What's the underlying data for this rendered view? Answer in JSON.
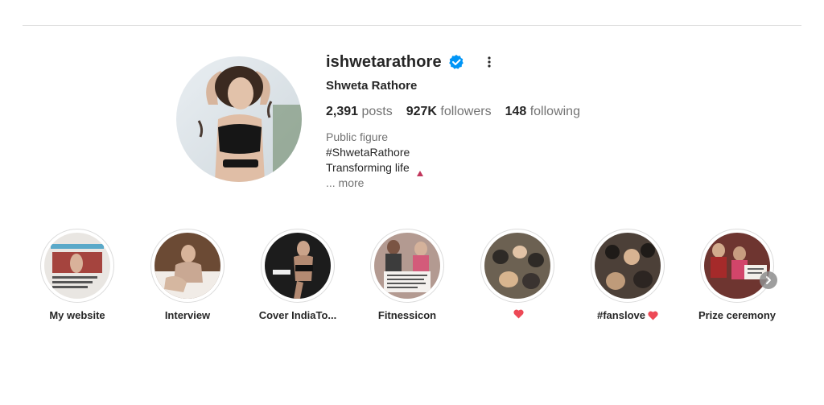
{
  "profile": {
    "username": "ishwetarathore",
    "full_name": "Shweta Rathore",
    "verified_icon": "verified-badge-icon",
    "options_icon": "more-options-icon",
    "stats": {
      "posts_count": "2,391",
      "posts_label": " posts",
      "followers_count": "927K",
      "followers_label": " followers",
      "following_count": "148",
      "following_label": " following"
    },
    "bio": {
      "category": "Public figure",
      "hashtag": "#ShwetaRathore",
      "tagline": "Transforming life",
      "more": "... more"
    }
  },
  "highlights": [
    {
      "label": "My website",
      "thumb_color": "#c9c3bd"
    },
    {
      "label": "Interview",
      "thumb_color": "#8a6a52"
    },
    {
      "label": "Cover IndiaTo...",
      "thumb_color": "#2a2a2a"
    },
    {
      "label": "Fitnessicon",
      "thumb_color": "#a88478"
    },
    {
      "label": "",
      "heart": true,
      "thumb_color": "#5a5043"
    },
    {
      "label": "#fanslove",
      "heart": true,
      "thumb_color": "#4a3d33"
    },
    {
      "label": "Prize ceremony",
      "thumb_color": "#7a3a32"
    }
  ],
  "colors": {
    "verified": "#0095f6",
    "heart": "#ed4956",
    "text": "#262626",
    "muted": "#737373"
  }
}
